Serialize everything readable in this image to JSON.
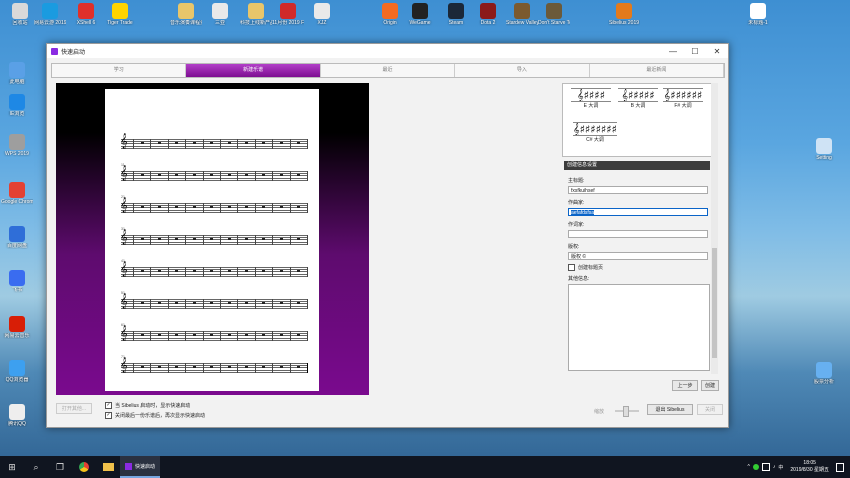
{
  "desktop": {
    "icons_top": [
      {
        "id": "recycle",
        "label": "回收站",
        "color": "#d9d9d9"
      },
      {
        "id": "netease",
        "label": "网易云游 2019.9.2(...",
        "color": "#1a9be0"
      },
      {
        "id": "xshell",
        "label": "XShell 6",
        "color": "#e0302a"
      },
      {
        "id": "tiger",
        "label": "Tiger Trade",
        "color": "#ffd400"
      },
      {
        "id": "folder1",
        "label": "音乐演奏课程资料",
        "color": "#e8c66a"
      },
      {
        "id": "sanya",
        "label": "三亚",
        "color": "#e9e9e9"
      },
      {
        "id": "folder2",
        "label": "科技上线新产品",
        "color": "#e8c66a"
      },
      {
        "id": "foxit",
        "label": "11月份 2019 Foxit...",
        "color": "#d02a2a"
      },
      {
        "id": "xjz",
        "label": "XJZ",
        "color": "#e9e9e9"
      },
      {
        "id": "origin",
        "label": "Origin",
        "color": "#f36b21"
      },
      {
        "id": "wegame",
        "label": "WeGame",
        "color": "#222"
      },
      {
        "id": "steam",
        "label": "Steam",
        "color": "#1b2838"
      },
      {
        "id": "dota2",
        "label": "Dota 2",
        "color": "#8b1a1a"
      },
      {
        "id": "stardew",
        "label": "Stardew Valley",
        "color": "#7b5a2f"
      },
      {
        "id": "dontstarve",
        "label": "Don't Starve Together",
        "color": "#6b5a3a"
      },
      {
        "id": "sibelius",
        "label": "Sibelius 2019",
        "color": "#e37a1c"
      },
      {
        "id": "untitled",
        "label": "未标题-1",
        "color": "#ffffff"
      }
    ],
    "icons_left": [
      {
        "id": "thispc",
        "label": "此电脑",
        "color": "#5aa0e6"
      },
      {
        "id": "ie",
        "label": "IE浏览",
        "color": "#1e88e5"
      },
      {
        "id": "wps",
        "label": "WPS 2019",
        "color": "#9e9e9e"
      },
      {
        "id": "chrome",
        "label": "Google Chrome",
        "color": "#e34133"
      },
      {
        "id": "baidu",
        "label": "百度网盘",
        "color": "#2f6ed8"
      },
      {
        "id": "feishu",
        "label": "飞书",
        "color": "#3a6cf0"
      },
      {
        "id": "music163",
        "label": "网易云音乐",
        "color": "#d81e06"
      },
      {
        "id": "qqbrowser",
        "label": "QQ浏览器",
        "color": "#3da0f0"
      },
      {
        "id": "qq",
        "label": "腾讯QQ",
        "color": "#eeeeee"
      }
    ],
    "icons_right": [
      {
        "id": "setting",
        "label": "Setting",
        "color": "#cfe3f5"
      },
      {
        "id": "stock",
        "label": "股票分析",
        "color": "#67b0f0"
      }
    ]
  },
  "window": {
    "title": "快速启动",
    "controls": {
      "minimize": "—",
      "maximize": "☐",
      "close": "✕"
    },
    "tabs": [
      {
        "label": "学习",
        "active": false
      },
      {
        "label": "新建乐谱",
        "active": true
      },
      {
        "label": "最近",
        "active": false
      },
      {
        "label": "导入",
        "active": false
      },
      {
        "label": "最近新闻",
        "active": false
      }
    ],
    "keys": [
      {
        "name": "E 大调",
        "sig": "𝄞♯♯♯♯"
      },
      {
        "name": "B 大调",
        "sig": "𝄞♯♯♯♯♯"
      },
      {
        "name": "F# 大调",
        "sig": "𝄞♯♯♯♯♯♯"
      },
      {
        "name": "C# 大调",
        "sig": "𝄞♯♯♯♯♯♯♯"
      }
    ],
    "section_header": "创建信息设置",
    "fields": {
      "title_label": "主标题:",
      "title_value": "fxsfkuihsef",
      "composer_label": "作曲家:",
      "composer_value": "aefafdsfsa",
      "lyricist_label": "作词家:",
      "lyricist_value": "",
      "copyright_label": "版权:",
      "copyright_value": "版权 ©",
      "title_page_label": "创建标题页",
      "other_label": "其他信息:"
    },
    "buttons": {
      "open_other": "打开其他...",
      "prev": "上一步",
      "create": "创建",
      "exit": "退出 Sibelius",
      "close": "关闭",
      "zoom_label": "缩放"
    },
    "checks": {
      "show_on_start": "当 Sibelius 启动时，显示快速启动",
      "show_on_close": "关闭最后一份乐谱后，再次显示快速启动"
    },
    "staff_measure_numbers": [
      "",
      "11",
      "21",
      "31",
      "41",
      "51",
      "61",
      "71"
    ]
  },
  "taskbar": {
    "start": "⊞",
    "search": "⌕",
    "taskview": "❐",
    "active_app": "快速启动",
    "tray_lang": "中",
    "time": "18:05",
    "date": "2019/8/30 星期五"
  }
}
